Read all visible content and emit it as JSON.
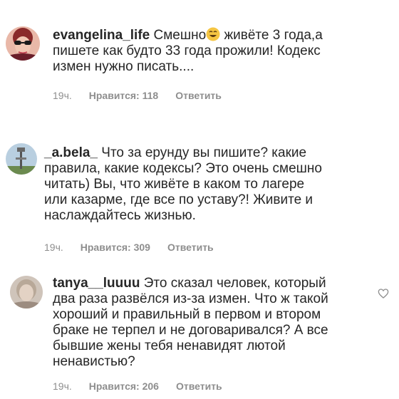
{
  "comments": [
    {
      "username": "evangelina_life",
      "text_lines": [
        "Смешно",
        " живёте 3 года,а",
        "пишете как будто 33 года прожили! Кодекс",
        "измен нужно писать...."
      ],
      "time": "19ч.",
      "likes": "Нравится: 118",
      "reply": "Ответить"
    },
    {
      "username": "_a.bela_",
      "text_lines": [
        " Что за ерунду вы пишите? какие",
        "правила, какие кодексы? Это очень смешно",
        "читать) Вы, что живёте в каком то лагере",
        "или казарме, где все по уставу?! Живите  и",
        "наслаждайтесь жизнью."
      ],
      "time": "19ч.",
      "likes": "Нравится: 309",
      "reply": "Ответить"
    },
    {
      "username": "tanya__luuuu",
      "text_lines": [
        " Это сказал человек, который",
        "два раза развёлся из-за измен. Что ж такой",
        "хороший и правильный в первом и втором",
        "браке не терпел и не договаривался? А все",
        "бывшие жены тебя ненавидят лютой",
        "ненавистью?"
      ],
      "time": "19ч.",
      "likes": "Нравится: 206",
      "reply": "Ответить"
    }
  ],
  "colors": {
    "text": "#262626",
    "meta": "#8e8e8e"
  },
  "icons": [
    "smiling-emoji-icon",
    "heart-icon"
  ]
}
